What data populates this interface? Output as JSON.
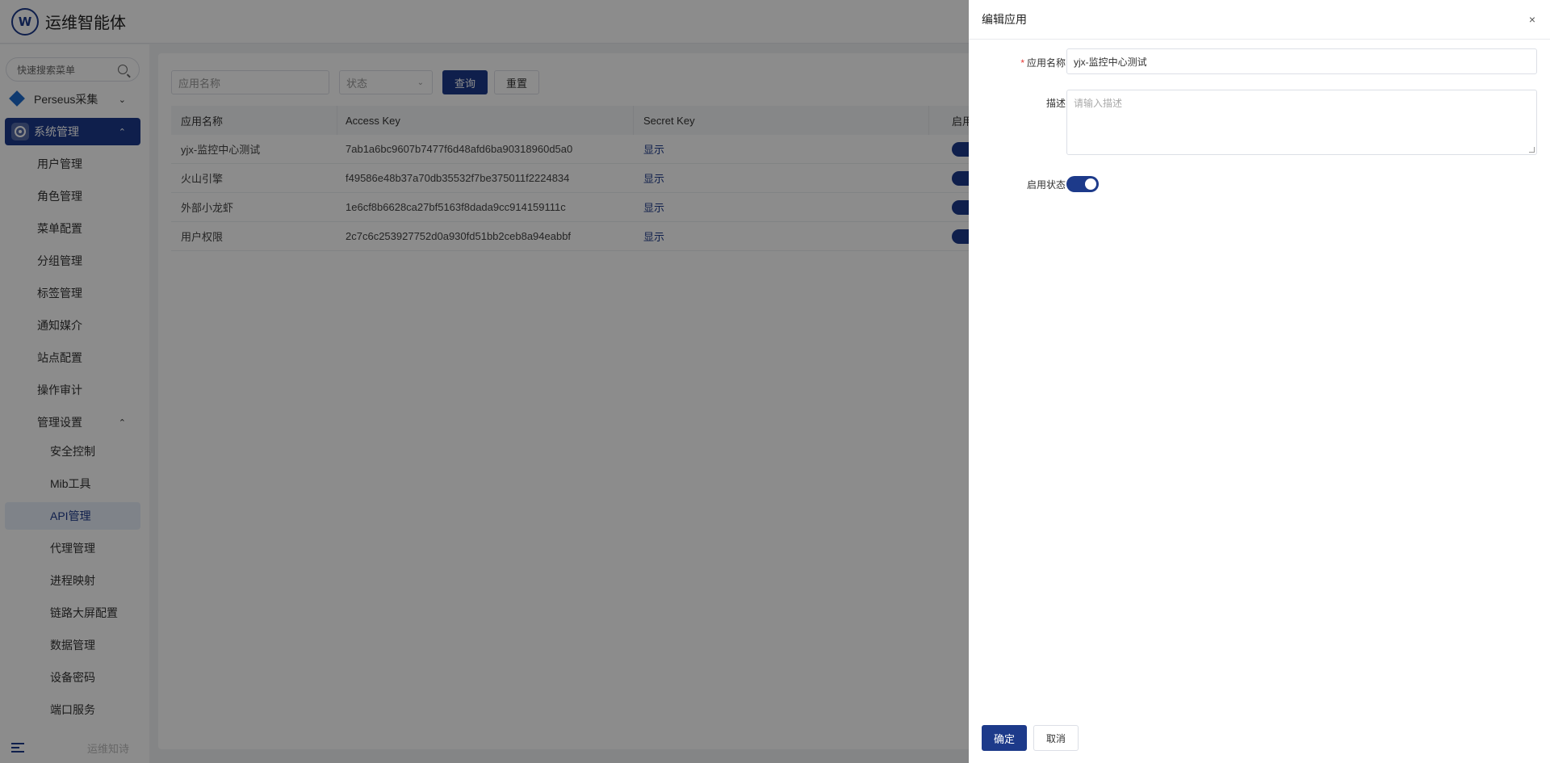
{
  "header": {
    "app_title": "运维智能体",
    "logo_glyph": "W"
  },
  "sidebar": {
    "search_placeholder": "快速搜索菜单",
    "groups": [
      {
        "label": "Perseus采集",
        "chevron": "⌄"
      },
      {
        "label": "系统管理",
        "chevron": "⌃"
      }
    ],
    "items": [
      {
        "label": "用户管理"
      },
      {
        "label": "角色管理"
      },
      {
        "label": "菜单配置"
      },
      {
        "label": "分组管理"
      },
      {
        "label": "标签管理"
      },
      {
        "label": "通知媒介"
      },
      {
        "label": "站点配置"
      },
      {
        "label": "操作审计"
      },
      {
        "label": "管理设置",
        "chevron": "⌃"
      }
    ],
    "sub_items": [
      {
        "label": "安全控制"
      },
      {
        "label": "Mib工具"
      },
      {
        "label": "API管理"
      },
      {
        "label": "代理管理"
      },
      {
        "label": "进程映射"
      },
      {
        "label": "链路大屏配置"
      },
      {
        "label": "数据管理"
      },
      {
        "label": "设备密码"
      },
      {
        "label": "端口服务"
      }
    ],
    "footer_text": "运维知诗"
  },
  "filters": {
    "name_placeholder": "应用名称",
    "status_placeholder": "状态",
    "query_label": "查询",
    "reset_label": "重置"
  },
  "table": {
    "columns": [
      "应用名称",
      "Access Key",
      "Secret Key",
      "启用"
    ],
    "rows": [
      {
        "name": "yjx-监控中心测试",
        "access_key": "7ab1a6bc9607b7477f6d48afd6ba90318960d5a0",
        "secret_key": "显示",
        "enabled": true
      },
      {
        "name": "火山引擎",
        "access_key": "f49586e48b37a70db35532f7be375011f2224834",
        "secret_key": "显示",
        "enabled": true
      },
      {
        "name": "外部小龙虾",
        "access_key": "1e6cf8b6628ca27bf5163f8dada9cc914159111c",
        "secret_key": "显示",
        "enabled": true
      },
      {
        "name": "用户权限",
        "access_key": "2c7c6c253927752d0a930fd51bb2ceb8a94eabbf",
        "secret_key": "显示",
        "enabled": true
      }
    ]
  },
  "drawer": {
    "title": "编辑应用",
    "close_glyph": "×",
    "fields": {
      "name_required_mark": "*",
      "name_label": "应用名称",
      "name_value": "yjx-监控中心测试",
      "desc_label": "描述",
      "desc_placeholder": "请输入描述",
      "status_label": "启用状态",
      "status_enabled": true
    },
    "confirm_label": "确定",
    "cancel_label": "取消"
  },
  "colors": {
    "primary": "#1d3a8a",
    "overlay": "rgba(0,0,0,0.45)",
    "required": "#e53935"
  }
}
